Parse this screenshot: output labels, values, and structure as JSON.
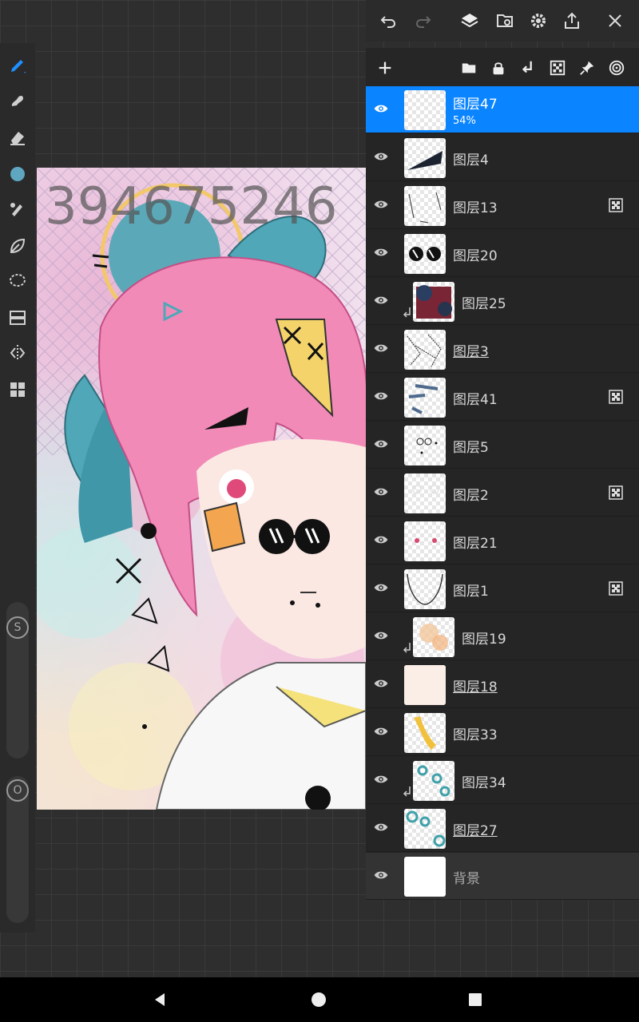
{
  "canvas": {
    "watermark_text": "394675246",
    "colors": {
      "pink_hair": "#f28ab8",
      "teal_bow": "#4fa7b7",
      "skin": "#fbe8e2"
    }
  },
  "toolbar_left": {
    "tools": [
      {
        "icon": "brush-icon",
        "active": true
      },
      {
        "icon": "smudge-icon"
      },
      {
        "icon": "eraser-icon"
      },
      {
        "icon": "color-swatch-icon",
        "color": "#5fa6c0"
      },
      {
        "icon": "fill-icon"
      },
      {
        "icon": "leaf-brush-icon"
      },
      {
        "icon": "lasso-select-icon"
      },
      {
        "icon": "gradient-icon"
      },
      {
        "icon": "symmetry-icon"
      },
      {
        "icon": "grid-menu-icon"
      }
    ],
    "size_slider_label": "S",
    "opacity_slider_label": "O"
  },
  "top_toolbar": {
    "buttons": [
      "undo-icon",
      "redo-icon",
      "layers-icon",
      "reference-icon",
      "settings-icon",
      "share-icon",
      "close-icon"
    ]
  },
  "layer_toolbar": {
    "buttons": [
      "add-layer-icon",
      "folder-icon",
      "lock-icon",
      "merge-down-icon",
      "alpha-lock-icon",
      "pin-icon",
      "target-icon"
    ]
  },
  "layers": [
    {
      "name": "图层47",
      "opacity": "54%",
      "selected": true
    },
    {
      "name": "图层4"
    },
    {
      "name": "图层13",
      "alpha_lock": true
    },
    {
      "name": "图层20"
    },
    {
      "name": "图层25",
      "clipped": true
    },
    {
      "name": "图层3",
      "underlined": true
    },
    {
      "name": "图层41",
      "alpha_lock": true
    },
    {
      "name": "图层5"
    },
    {
      "name": "图层2",
      "alpha_lock": true
    },
    {
      "name": "图层21"
    },
    {
      "name": "图层1",
      "alpha_lock": true
    },
    {
      "name": "图层19",
      "clipped": true
    },
    {
      "name": "图层18",
      "underlined": true
    },
    {
      "name": "图层33"
    },
    {
      "name": "图层34",
      "clipped": true
    },
    {
      "name": "图层27",
      "underlined": true
    },
    {
      "name": "背景",
      "background": true
    }
  ],
  "nav_bar": {
    "buttons": [
      "back-icon",
      "home-icon",
      "recents-icon"
    ]
  },
  "accent_color": "#0a84ff"
}
